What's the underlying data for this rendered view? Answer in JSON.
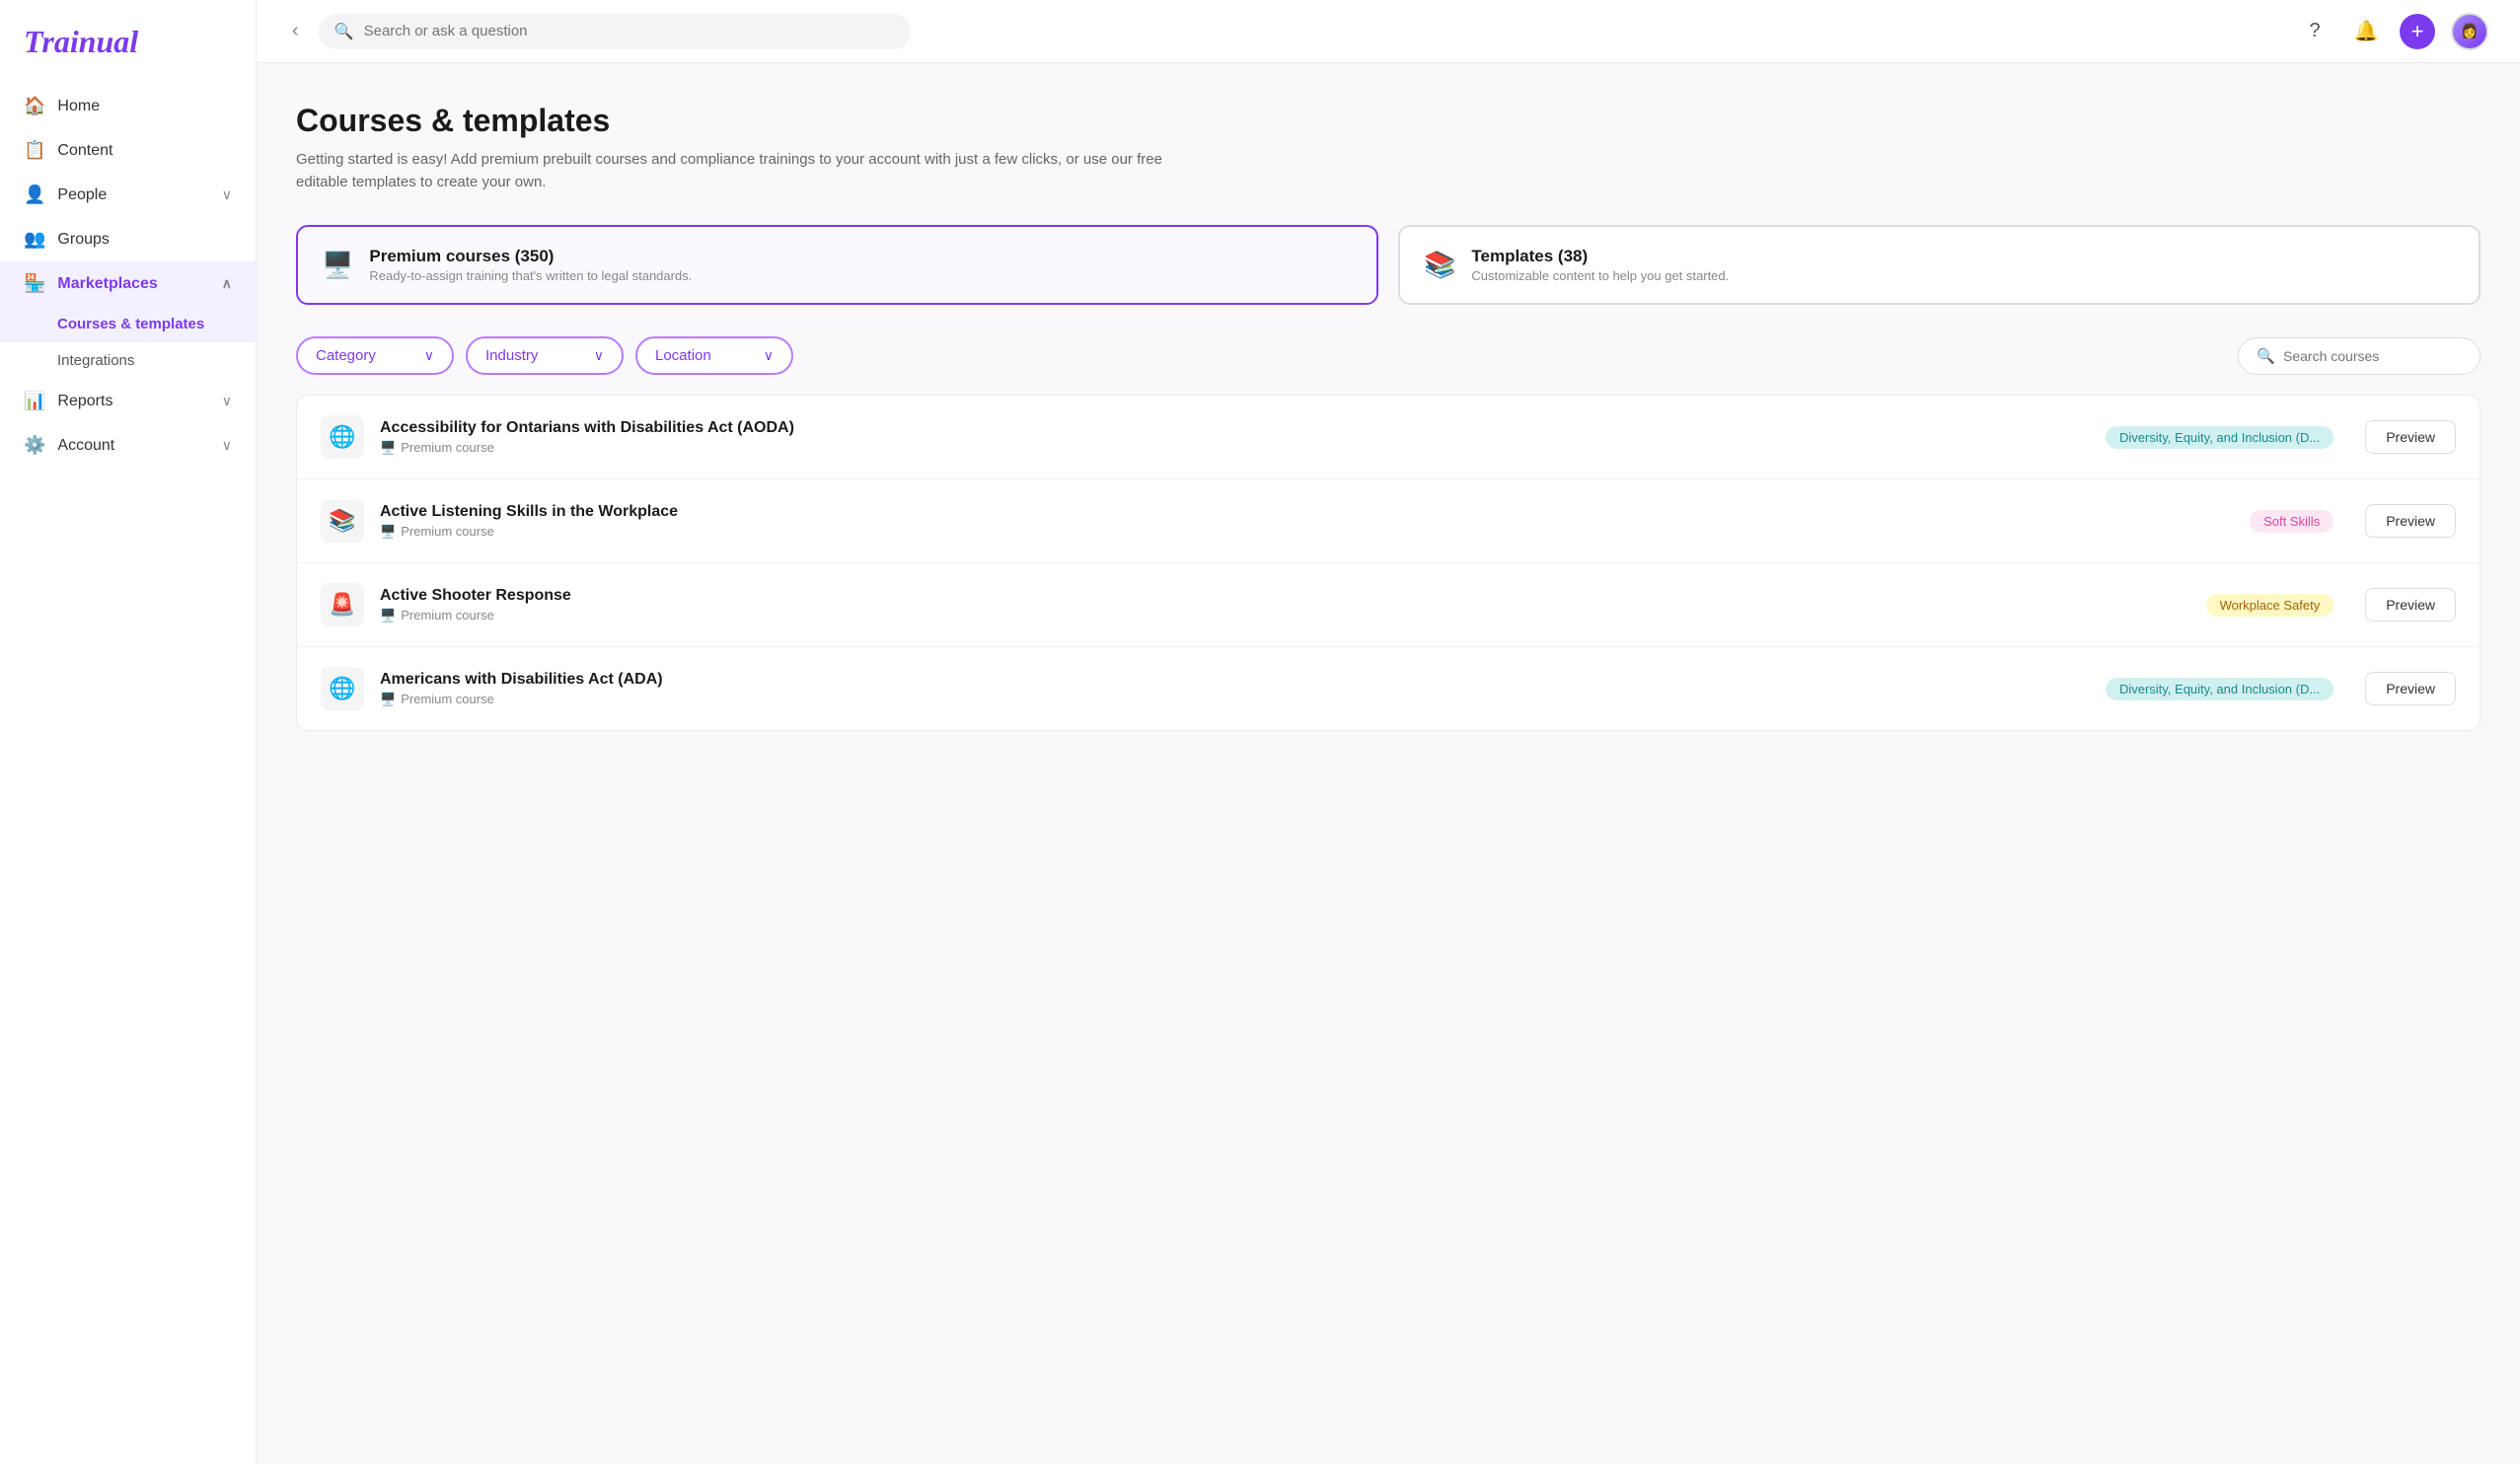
{
  "app": {
    "name": "Trainual"
  },
  "topbar": {
    "search_placeholder": "Search or ask a question",
    "collapse_icon": "‹"
  },
  "sidebar": {
    "items": [
      {
        "id": "home",
        "label": "Home",
        "icon": "🏠",
        "active": false
      },
      {
        "id": "content",
        "label": "Content",
        "icon": "📋",
        "active": false
      },
      {
        "id": "people",
        "label": "People",
        "icon": "👤",
        "active": false,
        "has_chevron": true
      },
      {
        "id": "groups",
        "label": "Groups",
        "icon": "👥",
        "active": false
      },
      {
        "id": "marketplaces",
        "label": "Marketplaces",
        "icon": "🏪",
        "active": true,
        "has_chevron": true
      },
      {
        "id": "courses-templates",
        "label": "Courses & templates",
        "active": true,
        "sub": true
      },
      {
        "id": "integrations",
        "label": "Integrations",
        "active": false,
        "sub": true,
        "secondary": true
      },
      {
        "id": "reports",
        "label": "Reports",
        "icon": "📊",
        "active": false,
        "has_chevron": true
      },
      {
        "id": "account",
        "label": "Account",
        "icon": "⚙️",
        "active": false,
        "has_chevron": true
      }
    ]
  },
  "page": {
    "title": "Courses & templates",
    "subtitle": "Getting started is easy! Add premium prebuilt courses and compliance trainings to your account with just a few clicks, or use our free editable templates to create your own."
  },
  "tabs": [
    {
      "id": "premium",
      "icon": "🖥️",
      "title": "Premium courses (350)",
      "subtitle": "Ready-to-assign training that's written to legal standards.",
      "active": true
    },
    {
      "id": "templates",
      "icon": "📚",
      "title": "Templates (38)",
      "subtitle": "Customizable content to help you get started.",
      "active": false
    }
  ],
  "filters": {
    "category_label": "Category",
    "industry_label": "Industry",
    "location_label": "Location",
    "search_placeholder": "Search courses"
  },
  "courses": [
    {
      "id": 1,
      "emoji": "🌐",
      "title": "Accessibility for Ontarians with Disabilities Act (AODA)",
      "type": "Premium course",
      "badge": "Diversity, Equity, and Inclusion (D...",
      "badge_class": "badge-dei",
      "preview_label": "Preview"
    },
    {
      "id": 2,
      "emoji": "📚",
      "title": "Active Listening Skills in the Workplace",
      "type": "Premium course",
      "badge": "Soft Skills",
      "badge_class": "badge-soft",
      "preview_label": "Preview"
    },
    {
      "id": 3,
      "emoji": "🚨",
      "title": "Active Shooter Response",
      "type": "Premium course",
      "badge": "Workplace Safety",
      "badge_class": "badge-safety",
      "preview_label": "Preview"
    },
    {
      "id": 4,
      "emoji": "🌐",
      "title": "Americans with Disabilities Act (ADA)",
      "type": "Premium course",
      "badge": "Diversity, Equity, and Inclusion (D...",
      "badge_class": "badge-dei",
      "preview_label": "Preview"
    }
  ],
  "buttons": {
    "add_label": "+",
    "preview_label": "Preview"
  }
}
